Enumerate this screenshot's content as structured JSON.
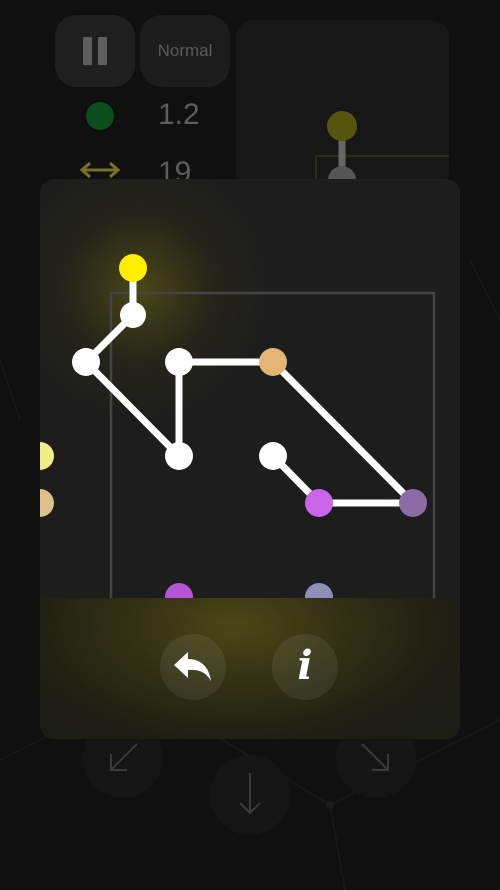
{
  "hud": {
    "pause_icon": "pause-icon",
    "difficulty": "Normal",
    "score_icon": "green-dot-icon",
    "score_value": "1.2",
    "moves_icon": "double-arrow-icon",
    "moves_value": "19"
  },
  "directions": {
    "down_left_icon": "arrow-down-left-icon",
    "down_icon": "arrow-down-icon",
    "down_right_icon": "arrow-down-right-icon"
  },
  "modal": {
    "undo_icon": "undo-icon",
    "info_icon": "info-icon",
    "info_glyph": "i"
  },
  "colors": {
    "background": "#101010",
    "panel": "#1d1d1d",
    "edge": "#ffffff",
    "node_white": "#ffffff",
    "node_yellow": "#ffee00",
    "node_orange": "#e3b673",
    "node_violet": "#c865e8",
    "node_mauve": "#8e6aa7",
    "node_pale_yellow": "#f0ec86",
    "node_tan": "#dcc18c",
    "node_lavender": "#8d8fb6",
    "node_purple": "#b455d6",
    "board_frame": "#444444",
    "moves_icon": "#77702a",
    "score_dot": "#0c4d1e"
  }
}
